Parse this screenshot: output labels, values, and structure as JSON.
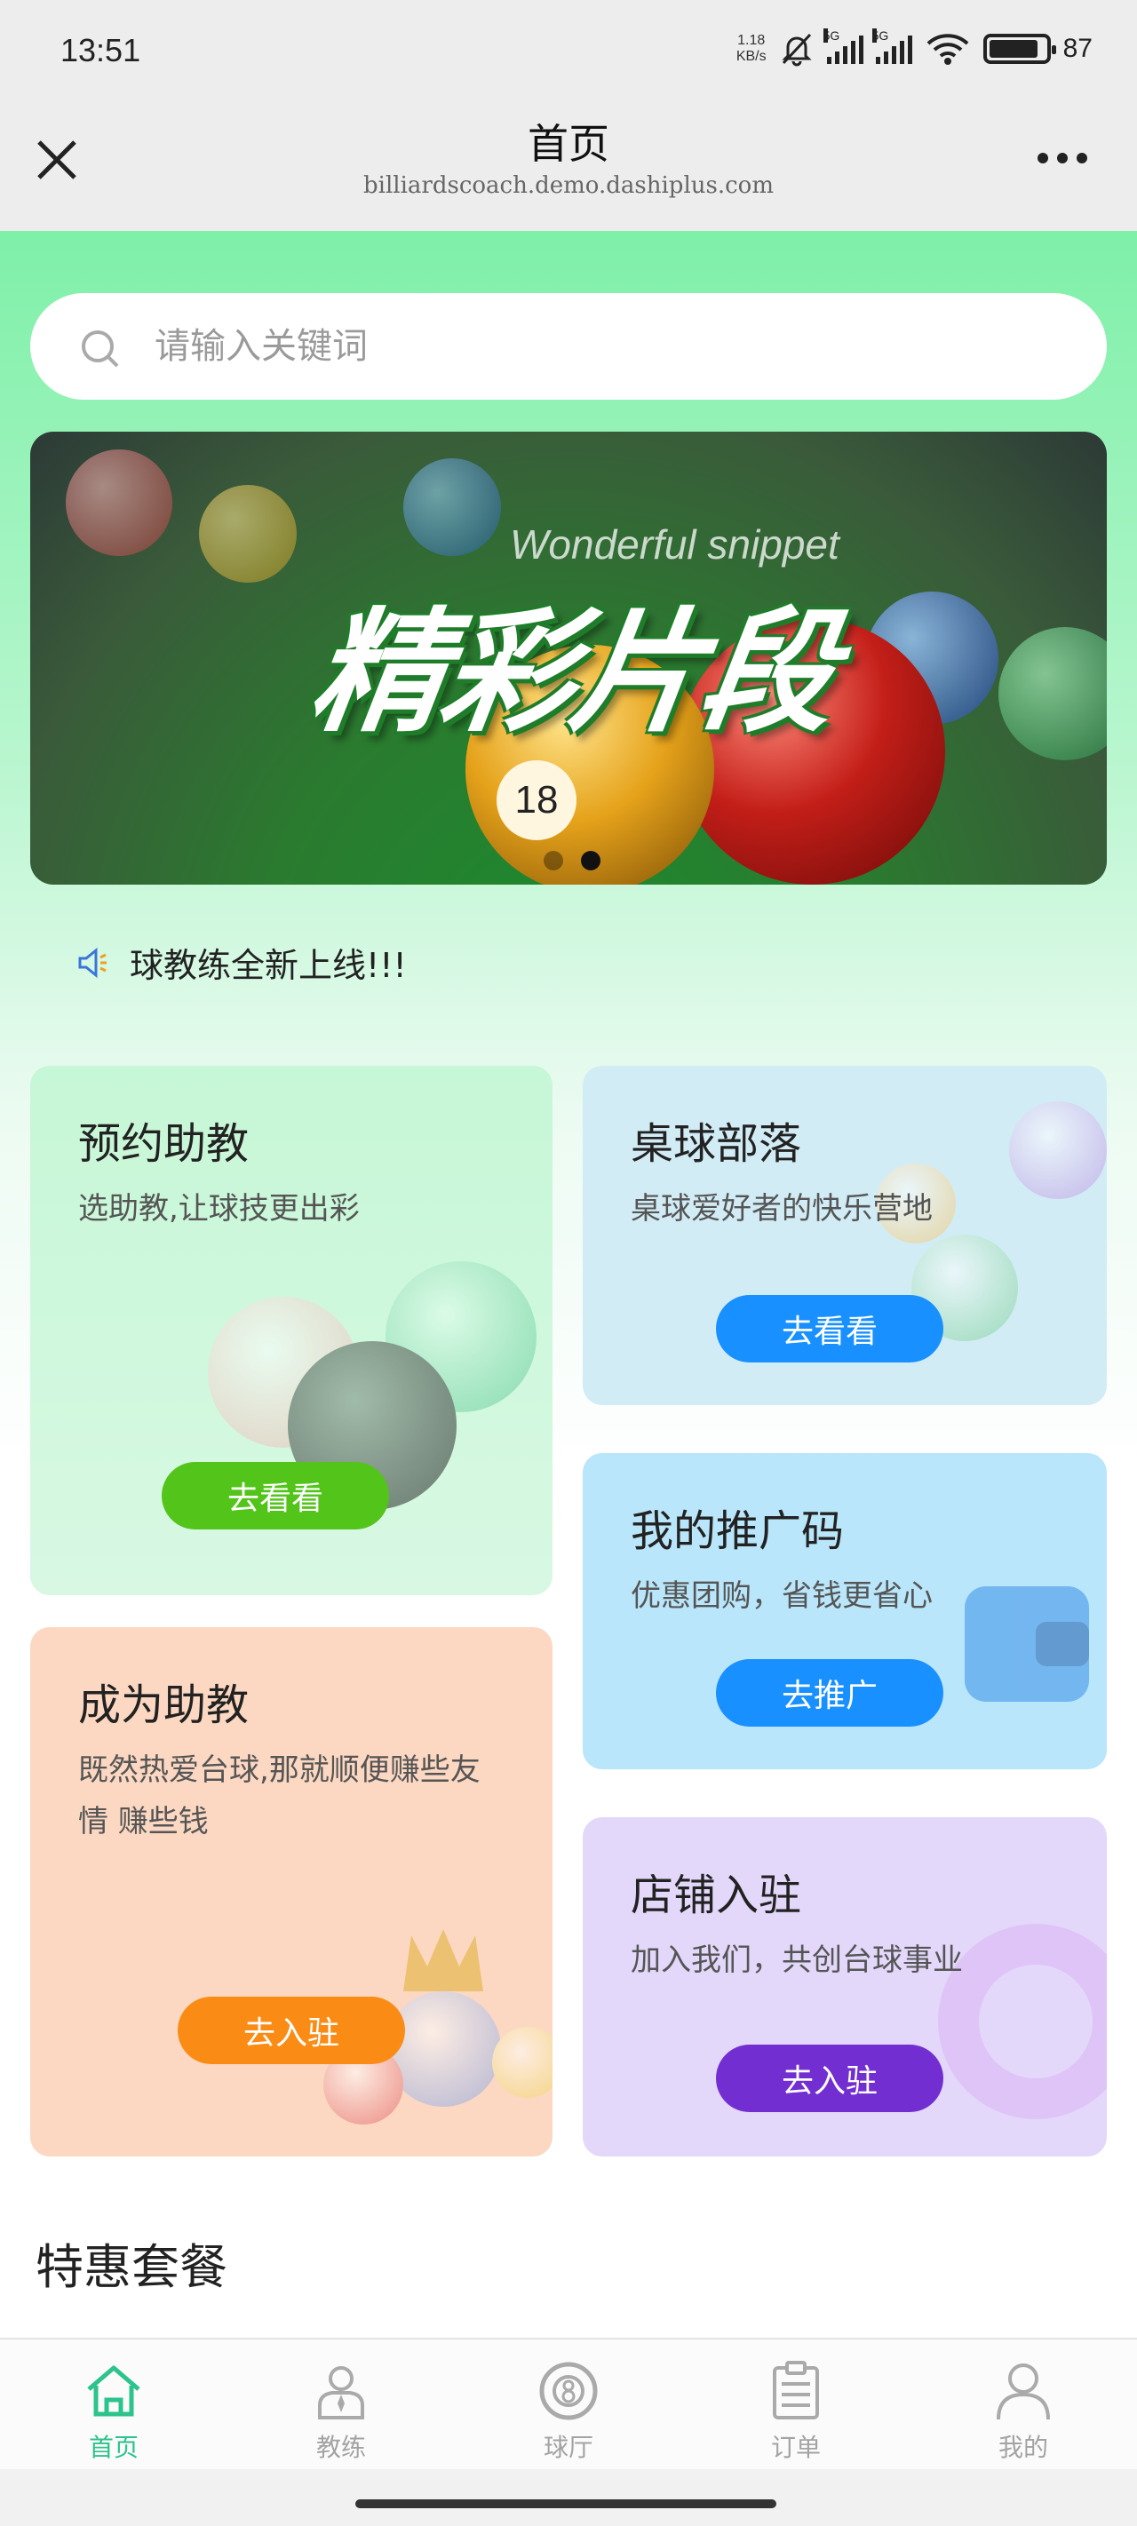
{
  "status_bar": {
    "time": "13:51",
    "net_speed_value": "1.18",
    "net_speed_unit": "KB/s",
    "signal1_tag": "5G",
    "signal2_tag": "5G",
    "battery_percent": "87",
    "battery_level": 0.87,
    "icons": [
      "bell-muted-icon",
      "signal-icon",
      "signal-icon",
      "wifi-icon",
      "battery-icon"
    ]
  },
  "title_bar": {
    "title": "首页",
    "url": "billiardscoach.demo.dashiplus.com"
  },
  "search": {
    "placeholder": "请输入关键词"
  },
  "banner": {
    "subtitle": "Wonderful snippet",
    "title": "精彩片段",
    "slides": 2,
    "active_slide": 2,
    "ball_number": "18"
  },
  "notice": {
    "text": "球教练全新上线!!!"
  },
  "cards": {
    "book_assistant": {
      "title": "预约助教",
      "desc": "选助教,让球技更出彩",
      "button": "去看看",
      "color": "#52c41a"
    },
    "billiards_tribe": {
      "title": "桌球部落",
      "desc": "桌球爱好者的快乐营地",
      "button": "去看看",
      "color": "#1890ff"
    },
    "promo_code": {
      "title": "我的推广码",
      "desc": "优惠团购，省钱更省心",
      "button": "去推广",
      "color": "#1890ff"
    },
    "become_assistant": {
      "title": "成为助教",
      "desc": "既然热爱台球,那就顺便赚些友情 赚些钱",
      "button": "去入驻",
      "color": "#fa8c16"
    },
    "shop_join": {
      "title": "店铺入驻",
      "desc": "加入我们，共创台球事业",
      "button": "去入驻",
      "color": "#722ed1"
    }
  },
  "section": {
    "title": "特惠套餐"
  },
  "bottom_nav": {
    "active": "home",
    "active_color": "#2cc38c",
    "items": [
      {
        "label": "首页",
        "icon": "home-icon"
      },
      {
        "label": "教练",
        "icon": "coach-icon"
      },
      {
        "label": "球厅",
        "icon": "billiard-hall-icon"
      },
      {
        "label": "订单",
        "icon": "order-icon"
      },
      {
        "label": "我的",
        "icon": "user-icon"
      }
    ]
  }
}
